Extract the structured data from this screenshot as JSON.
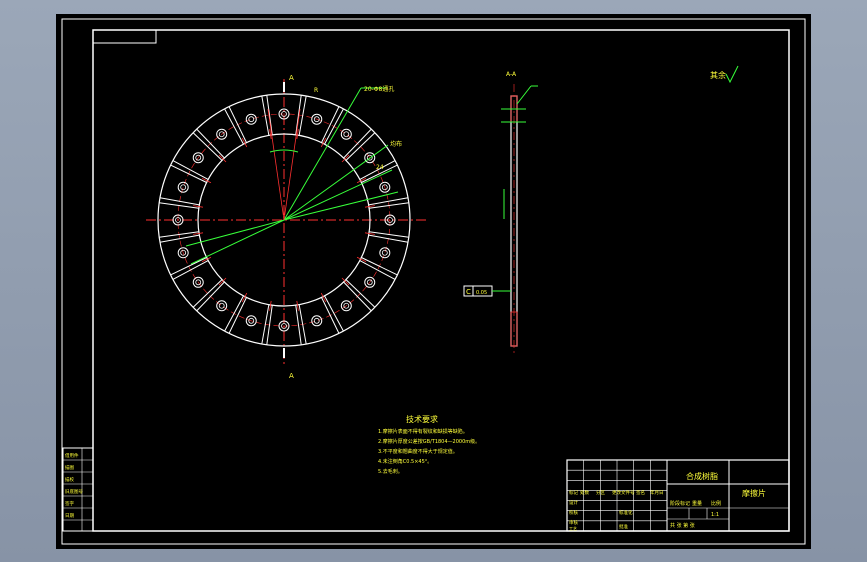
{
  "colors": {
    "background": "#000000",
    "frame": "#ffffff",
    "centerline": "#ff3030",
    "dimension": "#37ff3a",
    "text": "#ffff3a",
    "viewport": "#9ba7b8"
  },
  "front_view": {
    "section_label_top": "A",
    "section_label_bottom": "A",
    "callout_top": "R",
    "callout_right1": "20-Φ8通孔",
    "callout_right2": "均布",
    "callout_right3": "24"
  },
  "side_view": {
    "top_label": "A-A",
    "datum_label": "C",
    "datum_box_text": "0.05",
    "roughness_label": "其余"
  },
  "tech_req": {
    "title": "技术要求",
    "lines": [
      "1.摩擦片表面不得有裂纹和缺损等缺陷。",
      "2.摩擦片厚度公差按GB/T1804—2000m级。",
      "3.不平度和翘曲度不得大于规定值。",
      "4.未注倒角C0.5×45°。",
      "5.去毛刺。"
    ]
  },
  "title_block": {
    "material": "合成树脂",
    "part_name": "摩擦片",
    "scale": "1:1",
    "row_labels": [
      "标记",
      "设计",
      "校核",
      "审核",
      "工艺"
    ],
    "col_labels": [
      "处数",
      "分区",
      "更改文件号",
      "签名",
      "年月日"
    ],
    "stage_mark": "阶段标记",
    "weight": "重量",
    "ratio": "比例",
    "sheet": "共 张 第 张",
    "approve": "批准",
    "standard": "标准化"
  },
  "side_table": [
    "借用件",
    "描图",
    "描校",
    "旧底图号",
    "签字",
    "日期"
  ]
}
